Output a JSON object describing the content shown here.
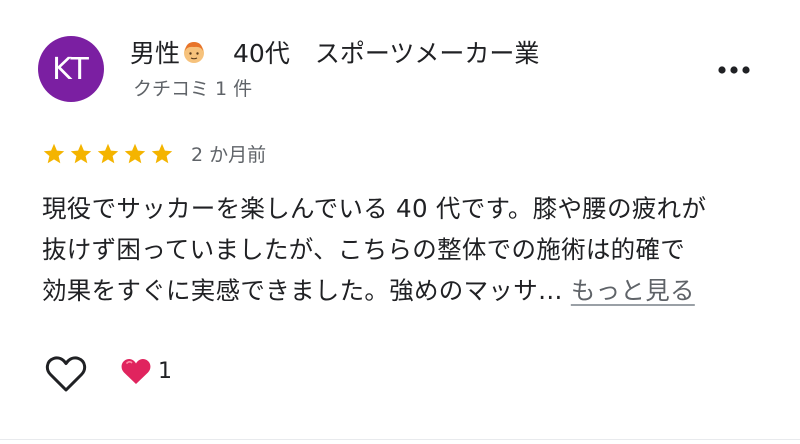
{
  "author": {
    "initials": "KT",
    "avatar_color": "#7b1fa2",
    "name_prefix": "男性",
    "name_suffix": "　40代　スポーツメーカー業",
    "emoji_icon": "man-face-icon",
    "meta": "クチコミ 1 件"
  },
  "review": {
    "rating": 5,
    "star_color": "#f4b400",
    "date": "2 か月前",
    "text_lines": [
      "現役でサッカーを楽しんでいる 40 代です。膝や腰の疲れが",
      "抜けず困っていましたが、こちらの整体での施術は的確で",
      "効果をすぐに実感できました。強めのマッサ…"
    ],
    "more_label": "もっと見る"
  },
  "actions": {
    "like_icon": "heart-outline-icon",
    "reaction_icon": "red-heart-icon",
    "reaction_color": "#e0245e",
    "reaction_count": "1"
  },
  "menu_icon": "more-vertical-icon"
}
